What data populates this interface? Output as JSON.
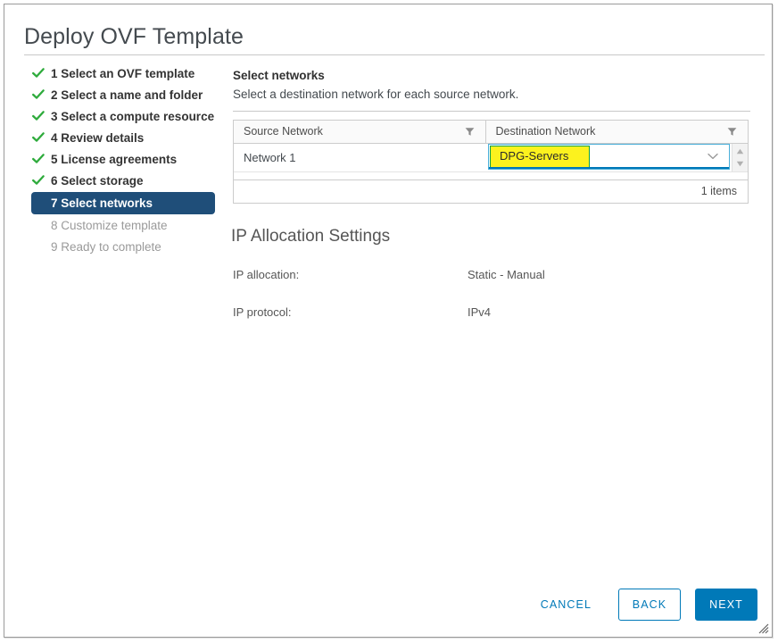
{
  "window": {
    "title": "Deploy OVF Template"
  },
  "steps": [
    {
      "label": "1 Select an OVF template",
      "state": "done"
    },
    {
      "label": "2 Select a name and folder",
      "state": "done"
    },
    {
      "label": "3 Select a compute resource",
      "state": "done"
    },
    {
      "label": "4 Review details",
      "state": "done"
    },
    {
      "label": "5 License agreements",
      "state": "done"
    },
    {
      "label": "6 Select storage",
      "state": "done"
    },
    {
      "label": "7 Select networks",
      "state": "active"
    },
    {
      "label": "8 Customize template",
      "state": "pending"
    },
    {
      "label": "9 Ready to complete",
      "state": "pending"
    }
  ],
  "pane": {
    "heading": "Select networks",
    "subheading": "Select a destination network for each source network."
  },
  "table": {
    "columns": [
      {
        "label": "Source Network",
        "filter_icon": "filter-icon"
      },
      {
        "label": "Destination Network",
        "filter_icon": "filter-icon"
      }
    ],
    "rows": [
      {
        "source": "Network 1",
        "destination_selected": "DPG-Servers"
      }
    ],
    "footer_count": "1 items",
    "scroll_up_icon": "triangle-up-icon",
    "scroll_down_icon": "triangle-down-icon",
    "dropdown_icon": "chevron-down-icon"
  },
  "ip_allocation": {
    "title": "IP Allocation Settings",
    "rows": [
      {
        "label": "IP allocation:",
        "value": "Static - Manual"
      },
      {
        "label": "IP protocol:",
        "value": "IPv4"
      }
    ]
  },
  "footer": {
    "cancel_label": "CANCEL",
    "back_label": "BACK",
    "next_label": "NEXT"
  },
  "colors": {
    "accent_blue": "#0079b8",
    "active_step_bg": "#1f4e79",
    "check_green": "#0a9e4a",
    "highlight_yellow": "#fcf21e",
    "focus_cyan": "#49afd9"
  }
}
